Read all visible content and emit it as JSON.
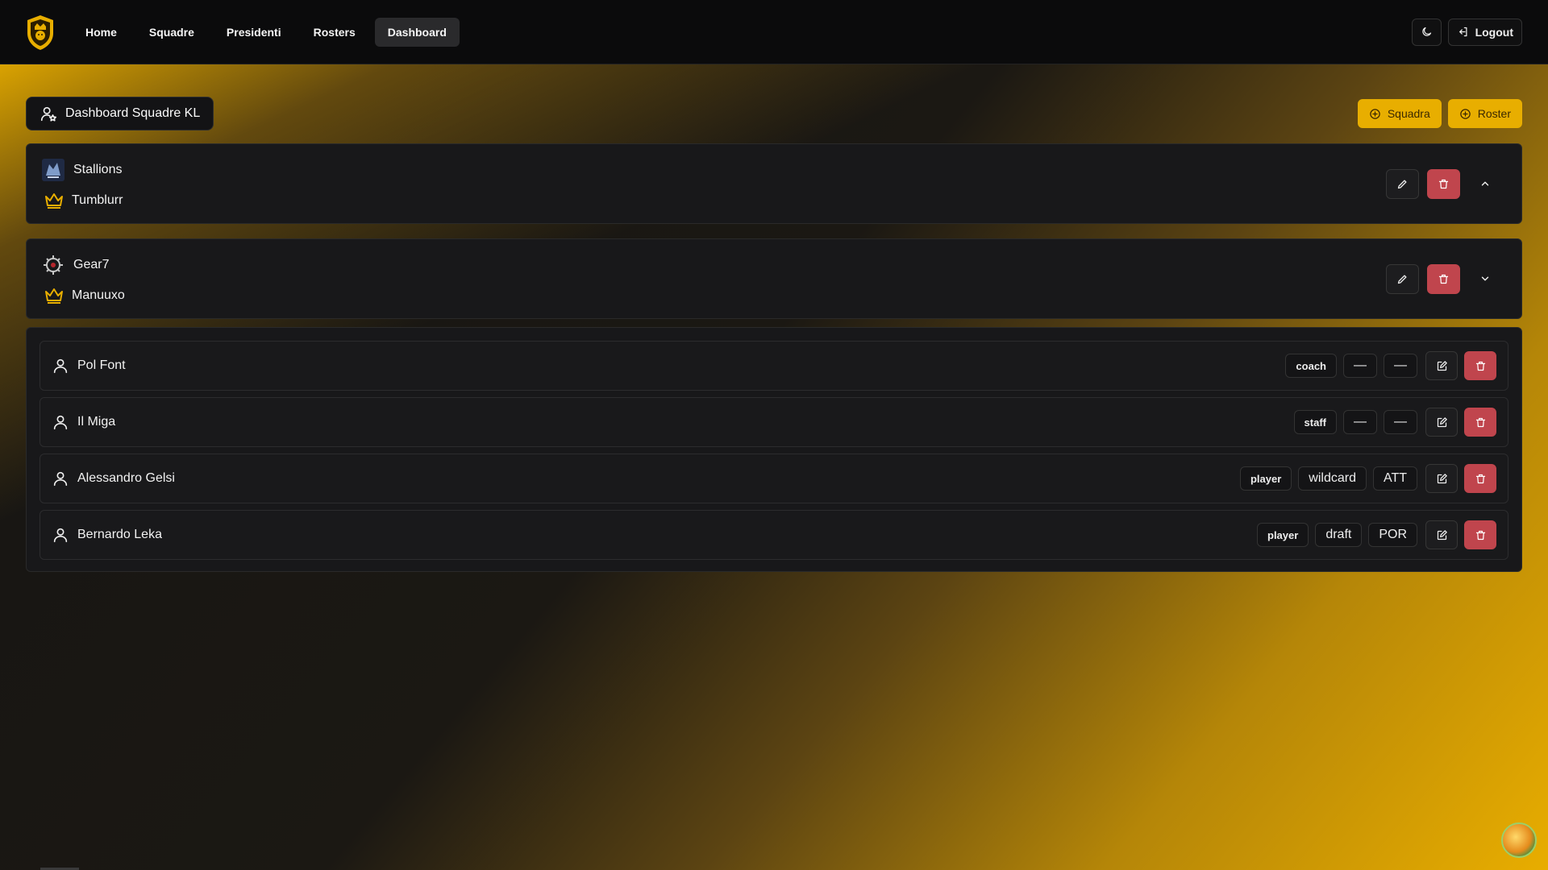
{
  "nav": {
    "items": [
      {
        "label": "Home",
        "active": false
      },
      {
        "label": "Squadre",
        "active": false
      },
      {
        "label": "Presidenti",
        "active": false
      },
      {
        "label": "Rosters",
        "active": false
      },
      {
        "label": "Dashboard",
        "active": true
      }
    ],
    "theme_icon": "moon-icon",
    "logout_label": "Logout"
  },
  "page": {
    "title": "Dashboard Squadre KL",
    "add_team_label": "Squadra",
    "add_roster_label": "Roster"
  },
  "teams": [
    {
      "name": "Stallions",
      "president": "Tumblurr",
      "expanded": false,
      "chevron": "chevron-up-icon"
    },
    {
      "name": "Gear7",
      "president": "Manuuxo",
      "expanded": true,
      "chevron": "chevron-down-icon"
    }
  ],
  "roster": [
    {
      "name": "Pol Font",
      "role": "coach",
      "acquisition": "—",
      "position": "—"
    },
    {
      "name": "Il Miga",
      "role": "staff",
      "acquisition": "—",
      "position": "—"
    },
    {
      "name": "Alessandro Gelsi",
      "role": "player",
      "acquisition": "wildcard",
      "position": "ATT"
    },
    {
      "name": "Bernardo Leka",
      "role": "player",
      "acquisition": "draft",
      "position": "POR"
    }
  ],
  "colors": {
    "accent": "#e8ae00",
    "danger": "#c0454d",
    "surface": "#18181a",
    "topbar": "#0b0b0c"
  }
}
